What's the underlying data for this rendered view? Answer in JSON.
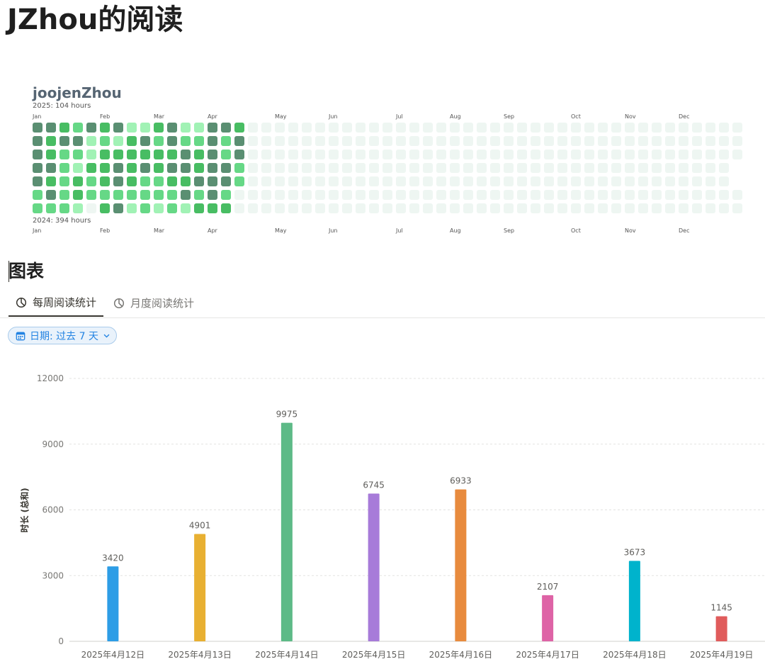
{
  "page": {
    "title": "JZhou的阅读"
  },
  "heatmap": {
    "user": "joojenZhou",
    "summary_2025": "2025: 104 hours",
    "summary_2024": "2024: 394 hours",
    "months": [
      "Jan",
      "Feb",
      "Mar",
      "Apr",
      "May",
      "Jun",
      "Jul",
      "Aug",
      "Sep",
      "Oct",
      "Nov",
      "Dec"
    ],
    "month_weeks": [
      0,
      5,
      9,
      13,
      18,
      22,
      27,
      31,
      35,
      40,
      44,
      48
    ],
    "weeks": 53,
    "active_weeks": 16,
    "levels": [
      "4432434113411443",
      "4344121342422424",
      "4322133333343424",
      "4421334343443442",
      "4323234322334442",
      "2423222222242420",
      "2221034121213330"
    ],
    "colors": [
      "#eef6f2",
      "#a1f2b5",
      "#66d886",
      "#48bd63",
      "#5a8f72"
    ]
  },
  "section": {
    "title": "图表"
  },
  "tabs": [
    {
      "label": "每周阅读统计",
      "icon": "pie-chart-icon",
      "active": true
    },
    {
      "label": "月度阅读统计",
      "icon": "pie-chart-icon",
      "active": false
    }
  ],
  "filter": {
    "label": "日期: 过去 7 天",
    "icon": "calendar-icon"
  },
  "chart_data": {
    "type": "bar",
    "categories": [
      "2025年4月12日",
      "2025年4月13日",
      "2025年4月14日",
      "2025年4月15日",
      "2025年4月16日",
      "2025年4月17日",
      "2025年4月18日",
      "2025年4月19日"
    ],
    "values": [
      3420,
      4901,
      9975,
      6745,
      6933,
      2107,
      3673,
      1145
    ],
    "colors": [
      "#2d9de6",
      "#e8b032",
      "#5dba87",
      "#a77bd9",
      "#e88b3e",
      "#de63a6",
      "#00b3cc",
      "#e05c5c"
    ],
    "ylabel": "时长 (总和)",
    "yticks": [
      0,
      3000,
      6000,
      9000,
      12000
    ],
    "ylim": [
      0,
      12000
    ],
    "grid": true,
    "data_labels": true
  }
}
